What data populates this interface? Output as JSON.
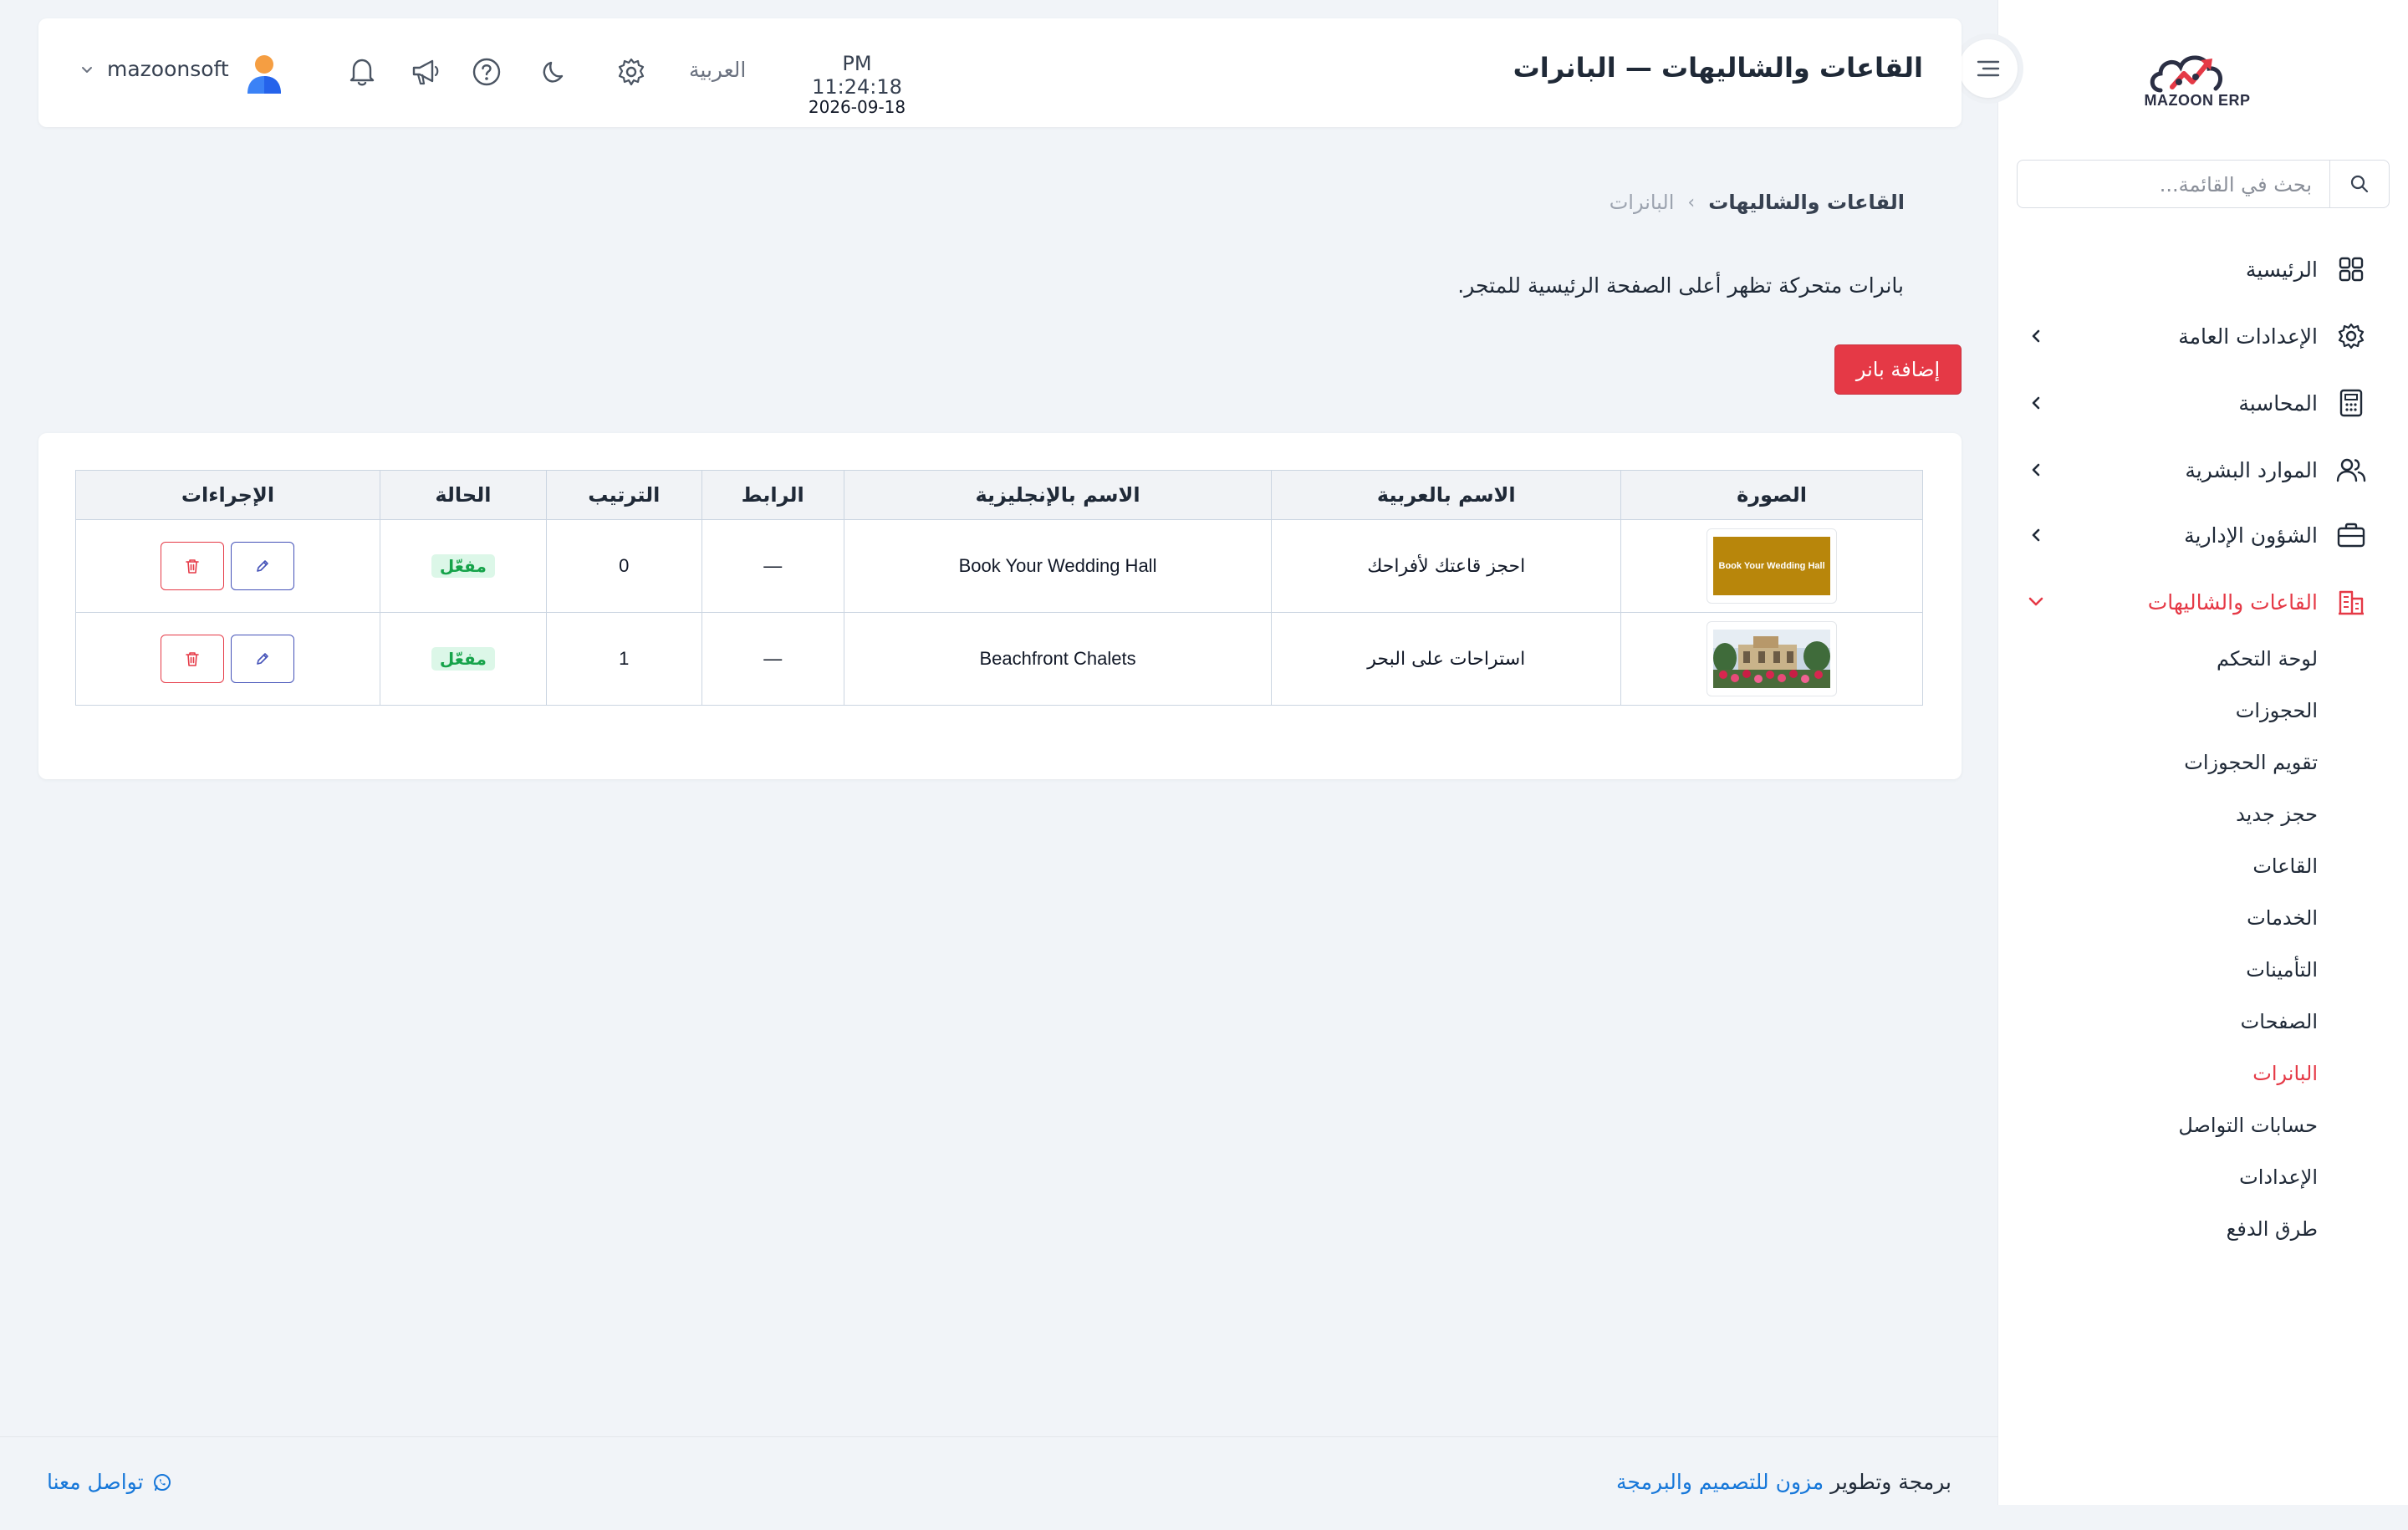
{
  "app": {
    "brand": "MAZOON ERP",
    "page_title": "القاعات والشاليهات — البانرات"
  },
  "header": {
    "time": "PM 11:24:18",
    "date": "2026-09-18",
    "language": "العربية",
    "username": "mazoonsoft",
    "icons": [
      "settings-icon",
      "moon-icon",
      "help-icon",
      "megaphone-icon",
      "bell-icon"
    ]
  },
  "sidebar": {
    "search_placeholder": "بحث في القائمة...",
    "items": [
      {
        "label": "الرئيسية",
        "icon": "grid-icon"
      },
      {
        "label": "الإعدادات العامة",
        "icon": "gear-icon"
      },
      {
        "label": "المحاسبة",
        "icon": "calculator-icon"
      },
      {
        "label": "الموارد البشرية",
        "icon": "users-icon"
      },
      {
        "label": "الشؤون الإدارية",
        "icon": "briefcase-icon"
      },
      {
        "label": "القاعات والشاليهات",
        "icon": "building-icon",
        "active": true
      }
    ],
    "sub_items": [
      {
        "label": "لوحة التحكم"
      },
      {
        "label": "الحجوزات"
      },
      {
        "label": "تقويم الحجوزات"
      },
      {
        "label": "حجز جديد"
      },
      {
        "label": "القاعات"
      },
      {
        "label": "الخدمات"
      },
      {
        "label": "التأمينات"
      },
      {
        "label": "الصفحات"
      },
      {
        "label": "البانرات",
        "active": true
      },
      {
        "label": "حسابات التواصل"
      },
      {
        "label": "الإعدادات"
      },
      {
        "label": "طرق الدفع"
      }
    ]
  },
  "breadcrumb": {
    "parent": "القاعات والشاليهات",
    "separator": "›",
    "current": "البانرات"
  },
  "intro": "بانرات متحركة تظهر أعلى الصفحة الرئيسية للمتجر.",
  "add_button": "إضافة بانر",
  "table": {
    "headers": [
      "الصورة",
      "الاسم بالعربية",
      "الاسم بالإنجليزية",
      "الرابط",
      "الترتيب",
      "الحالة",
      "الإجراءات"
    ],
    "rows": [
      {
        "image_text": "Book Your Wedding Hall",
        "name_ar": "احجز قاعتك لأفراحك",
        "name_en": "Book Your Wedding Hall",
        "link": "—",
        "order": "0",
        "status": "مفعّل"
      },
      {
        "image_text": "",
        "name_ar": "استراحات على البحر",
        "name_en": "Beachfront Chalets",
        "link": "—",
        "order": "1",
        "status": "مفعّل"
      }
    ]
  },
  "footer": {
    "credit_prefix": "برمجة وتطوير",
    "credit_link": "مزون للتصميم والبرمجة",
    "contact": "تواصل معنا"
  },
  "colors": {
    "accent": "#e53946",
    "link": "#1677d9",
    "status_green": "#16a34a",
    "edit_blue": "#4452b8",
    "background": "#f1f4f8"
  }
}
